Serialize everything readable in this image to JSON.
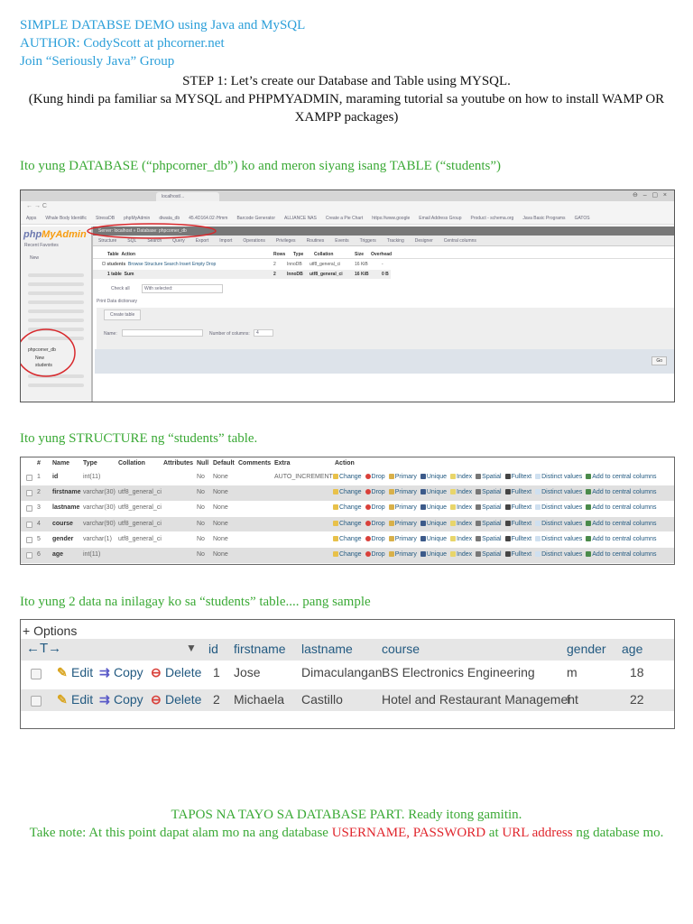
{
  "header": {
    "line1": "SIMPLE DATABSE DEMO using Java and MySQL",
    "line2": "AUTHOR: CodyScott at phcorner.net",
    "line3": "Join “Seriously Java” Group"
  },
  "step": {
    "line1": "STEP 1: Let’s create our Database and Table using MYSQL.",
    "line2": "(Kung hindi pa familiar sa MYSQL and PHPMYADMIN, maraming tutorial sa youtube on how to install WAMP OR",
    "line3": "XAMPP packages)"
  },
  "section1": {
    "heading": "Ito yung DATABASE (“phpcorner_db”) ko and meron siyang isang TABLE (“students”)",
    "screenshot": {
      "browser_tab": "localhost/...",
      "bookmarks": [
        "Apps",
        "Whale Body Identific",
        "StressDB",
        "phpMyAdmin",
        "diwata_db",
        "45.4D164.02 /Hmm",
        "Barcode Generator",
        "ALLIANCE NAS",
        "Create a Pie Chart",
        "https://www.google",
        "Email Address Group",
        "Product - schema.org",
        "Java Basic Programs",
        "GATOS"
      ],
      "logo_php": "php",
      "logo_myadmin": "MyAdmin",
      "nav_labels": [
        "Recent",
        "Favorites"
      ],
      "tree": {
        "new": "New",
        "db": "phpcorner_db",
        "new2": "New",
        "table": "students"
      },
      "breadcrumb": "Server: localhost » Database: phpcorner_db",
      "tabs": [
        "Structure",
        "SQL",
        "Search",
        "Query",
        "Export",
        "Import",
        "Operations",
        "Privileges",
        "Routines",
        "Events",
        "Triggers",
        "Tracking",
        "Designer",
        "Central columns"
      ],
      "table_headers": [
        "Table",
        "Action",
        "Rows",
        "Type",
        "Collation",
        "Size",
        "Overhead"
      ],
      "table_row": {
        "name": "students",
        "actions": "Browse  Structure  Search  Insert  Empty  Drop",
        "rows": "2",
        "type": "InnoDB",
        "collation": "utf8_general_ci",
        "size": "16 KiB",
        "overhead": "-"
      },
      "sum_row": {
        "name": "1 table",
        "label": "Sum",
        "rows": "2",
        "type": "InnoDB",
        "collation": "utf8_general_ci",
        "size": "16 KiB",
        "overhead": "0 B"
      },
      "check_all": "Check all",
      "with_selected": "With selected:",
      "print": "Print",
      "data_dictionary": "Data dictionary",
      "create_table": "Create table",
      "name_label": "Name:",
      "num_columns_label": "Number of columns:",
      "num_columns_value": "4",
      "go": "Go"
    }
  },
  "section2": {
    "heading": "Ito yung STRUCTURE ng “students” table.",
    "headers": [
      "#",
      "Name",
      "Type",
      "Collation",
      "Attributes",
      "Null",
      "Default",
      "Comments",
      "Extra",
      "Action"
    ],
    "rows": [
      {
        "num": "1",
        "name": "id",
        "type": "int(11)",
        "collation": "",
        "null": "No",
        "default": "None",
        "extra": "AUTO_INCREMENT"
      },
      {
        "num": "2",
        "name": "firstname",
        "type": "varchar(30)",
        "collation": "utf8_general_ci",
        "null": "No",
        "default": "None",
        "extra": ""
      },
      {
        "num": "3",
        "name": "lastname",
        "type": "varchar(30)",
        "collation": "utf8_general_ci",
        "null": "No",
        "default": "None",
        "extra": ""
      },
      {
        "num": "4",
        "name": "course",
        "type": "varchar(90)",
        "collation": "utf8_general_ci",
        "null": "No",
        "default": "None",
        "extra": ""
      },
      {
        "num": "5",
        "name": "gender",
        "type": "varchar(1)",
        "collation": "utf8_general_ci",
        "null": "No",
        "default": "None",
        "extra": ""
      },
      {
        "num": "6",
        "name": "age",
        "type": "int(11)",
        "collation": "",
        "null": "No",
        "default": "None",
        "extra": ""
      }
    ],
    "actions": [
      "Change",
      "Drop",
      "Primary",
      "Unique",
      "Index",
      "Spatial",
      "Fulltext",
      "Distinct values",
      "Add to central columns"
    ]
  },
  "section3": {
    "heading": "Ito yung 2 data na inilagay ko sa “students” table.... pang sample",
    "options": "+ Options",
    "arrows": "←T→",
    "headers": [
      "id",
      "firstname",
      "lastname",
      "course",
      "gender",
      "age"
    ],
    "row_actions": [
      "Edit",
      "Copy",
      "Delete"
    ],
    "rows": [
      {
        "id": "1",
        "firstname": "Jose",
        "lastname": "Dimaculangan",
        "course": "BS Electronics Engineering",
        "gender": "m",
        "age": "18"
      },
      {
        "id": "2",
        "firstname": "Michaela",
        "lastname": "Castillo",
        "course": "Hotel and Restaurant Management",
        "gender": "f",
        "age": "22"
      }
    ]
  },
  "footer": {
    "line1": "TAPOS NA TAYO SA DATABASE PART. Ready itong gamitin.",
    "line2_a": "Take note: At this point dapat alam mo na ang database ",
    "line2_b": "USERNAME, PASSWORD",
    "line2_c": " at ",
    "line2_d": "URL address",
    "line2_e": " ng database mo."
  },
  "colors": {
    "blue": "#2b9fd9",
    "green": "#3aa935",
    "red": "#e0262d"
  }
}
